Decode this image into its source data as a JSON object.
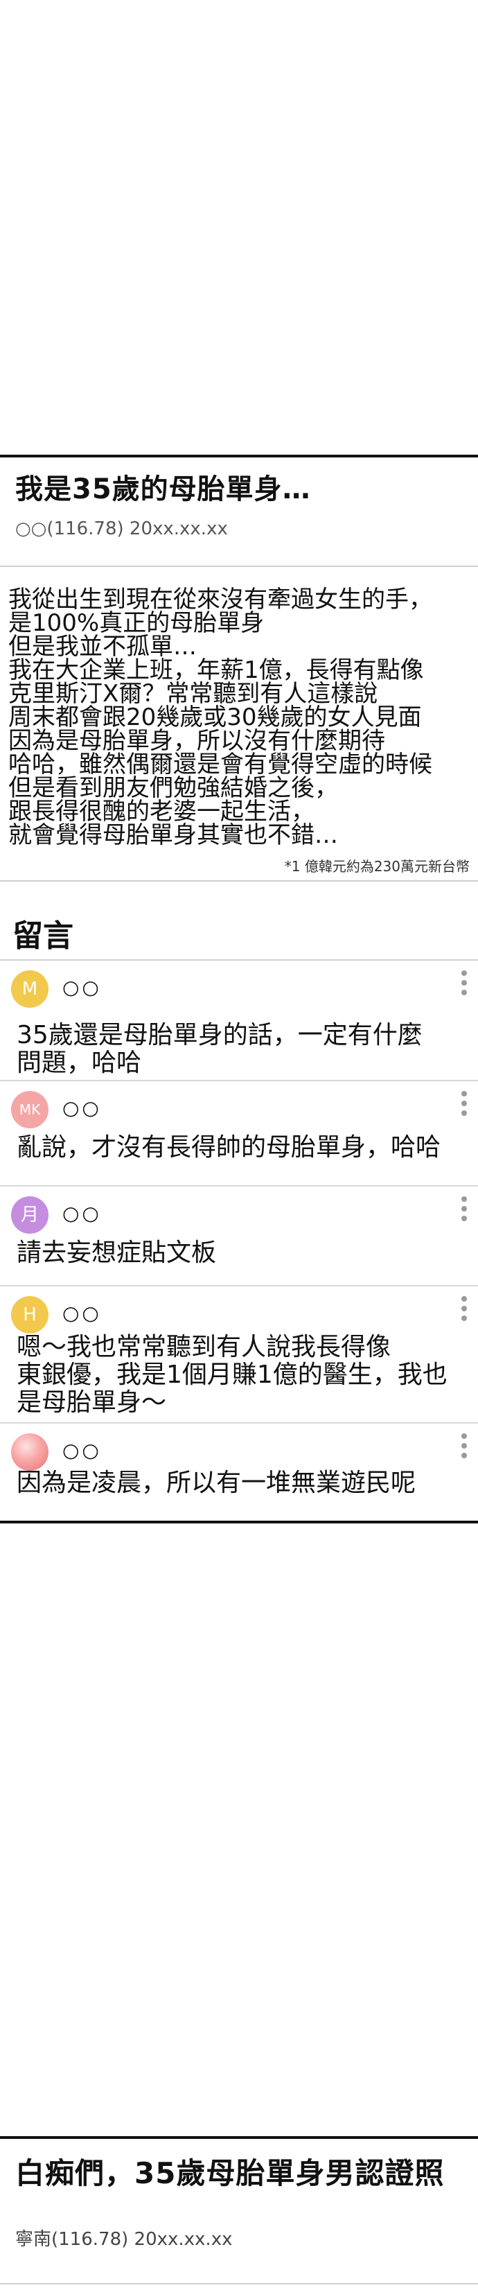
{
  "post1": {
    "title": "我是35歲的母胎單身…",
    "author": "○○(116.78)",
    "date": "20xx.xx.xx",
    "body_lines": [
      "我從出生到現在從來沒有牽過女生的手，",
      "是100%真正的母胎單身",
      "但是我並不孤單…",
      "我在大企業上班，年薪1億，長得有點像",
      "克里斯汀X爾？常常聽到有人這樣說",
      "周末都會跟20幾歲或30幾歲的女人見面",
      "因為是母胎單身，所以沒有什麼期待",
      "哈哈，雖然偶爾還是會有覺得空虛的時候",
      "但是看到朋友們勉強結婚之後，",
      "跟長得很醜的老婆一起生活，",
      "就會覺得母胎單身其實也不錯…"
    ],
    "footnote": "*1 億韓元約為230萬元新台幣"
  },
  "comments_header": "留言",
  "comments": [
    {
      "avatar_letter": "M",
      "avatar_color": "#f2c94c",
      "username": "○○",
      "text_lines": [
        "35歲還是母胎單身的話，一定有什麼",
        "問題，哈哈"
      ]
    },
    {
      "avatar_letter": "MK",
      "avatar_color": "#f4a6a6",
      "username": "○○",
      "text_lines": [
        "亂說，才沒有長得帥的母胎單身，哈哈"
      ]
    },
    {
      "avatar_letter": "月",
      "avatar_color": "#c58de0",
      "username": "○○",
      "text_lines": [
        "請去妄想症貼文板"
      ]
    },
    {
      "avatar_letter": "H",
      "avatar_color": "#f2c94c",
      "username": "○○",
      "text_lines": [
        "嗯～我也常常聽到有人說我長得像",
        "東銀優，我是1個月賺1億的醫生，我也",
        "是母胎單身～"
      ]
    },
    {
      "avatar_letter": "",
      "avatar_color": "#e57373",
      "username": "○○",
      "text_lines": [
        "因為是凌晨，所以有一堆無業遊民呢"
      ]
    }
  ],
  "post2": {
    "title": "白痴們，35歲母胎單身男認證照",
    "author": "寧南(116.78)",
    "date": "20xx.xx.xx"
  }
}
